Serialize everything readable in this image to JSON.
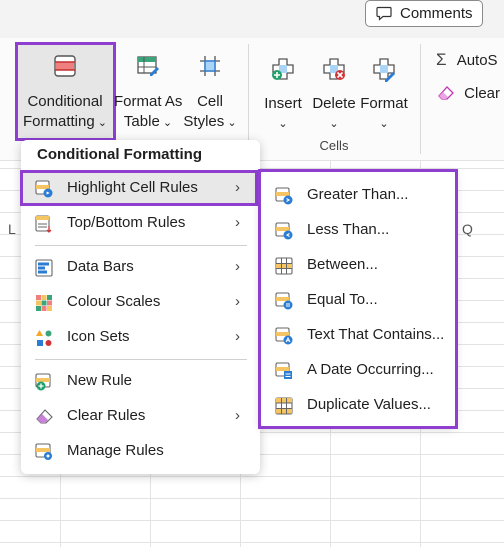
{
  "top": {
    "comments_label": "Comments"
  },
  "ribbon": {
    "conditional_formatting": {
      "line1": "Conditional",
      "line2": "Formatting"
    },
    "format_as_table": {
      "line1": "Format As",
      "line2": "Table"
    },
    "cell_styles": {
      "line1": "Cell",
      "line2": "Styles"
    },
    "insert_label": "Insert",
    "delete_label": "Delete",
    "format_label": "Format",
    "cells_group_label": "Cells",
    "autosum_label": "AutoS",
    "clear_label": "Clear"
  },
  "grid": {
    "col_l": "L",
    "col_q": "Q"
  },
  "menu": {
    "header": "Conditional Formatting",
    "items": [
      {
        "label": "Highlight Cell Rules",
        "icon": "highlight-cells-icon",
        "submenu": true
      },
      {
        "label": "Top/Bottom Rules",
        "icon": "top-bottom-icon",
        "submenu": true
      },
      {
        "label": "Data Bars",
        "icon": "data-bars-icon",
        "submenu": true
      },
      {
        "label": "Colour Scales",
        "icon": "colour-scales-icon",
        "submenu": true
      },
      {
        "label": "Icon Sets",
        "icon": "icon-sets-icon",
        "submenu": true
      },
      {
        "label": "New Rule",
        "icon": "new-rule-icon",
        "submenu": false
      },
      {
        "label": "Clear Rules",
        "icon": "eraser-icon",
        "submenu": true
      },
      {
        "label": "Manage Rules",
        "icon": "manage-rules-icon",
        "submenu": false
      }
    ]
  },
  "submenu": {
    "items": [
      {
        "label": "Greater Than...",
        "icon": "greater-than-icon"
      },
      {
        "label": "Less Than...",
        "icon": "less-than-icon"
      },
      {
        "label": "Between...",
        "icon": "between-icon"
      },
      {
        "label": "Equal To...",
        "icon": "equal-to-icon"
      },
      {
        "label": "Text That Contains...",
        "icon": "text-contains-icon"
      },
      {
        "label": "A Date Occurring...",
        "icon": "date-occurring-icon"
      },
      {
        "label": "Duplicate Values...",
        "icon": "duplicate-values-icon"
      }
    ]
  },
  "colors": {
    "highlight_border": "#8e3fd0"
  }
}
